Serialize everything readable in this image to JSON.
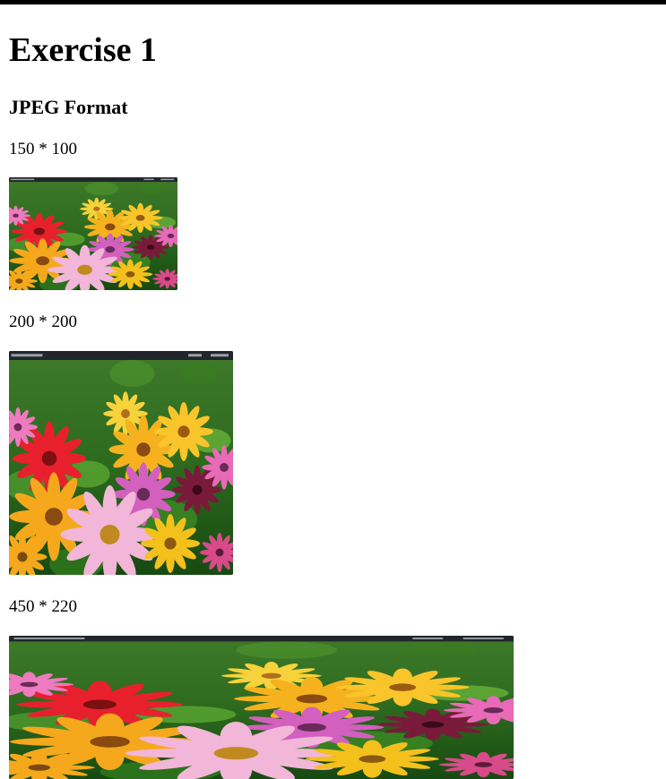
{
  "page": {
    "title": "Exercise 1",
    "section_heading": "JPEG Format"
  },
  "images": [
    {
      "caption": "150 * 100",
      "alt": "Flowers in a garden (screenshot of image viewer)"
    },
    {
      "caption": "200 * 200",
      "alt": "Flowers in a garden (screenshot of image viewer)"
    },
    {
      "caption": "450 * 220",
      "alt": "Flowers in a garden (screenshot of image viewer)"
    }
  ]
}
